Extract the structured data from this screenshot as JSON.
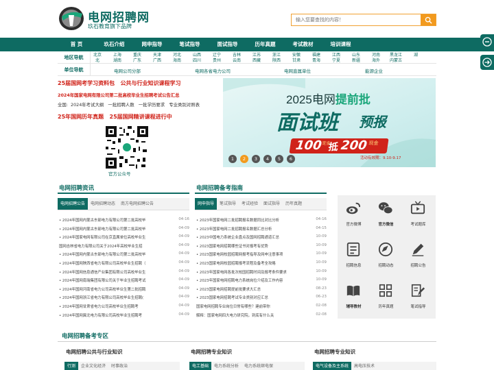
{
  "header": {
    "title": "电网招聘网",
    "subtitle": "玖石教育旗下品牌",
    "search_placeholder": "输入您要查找的内容！"
  },
  "nav": [
    "首 页",
    "玖石介绍",
    "网申指导",
    "笔试指导",
    "面试指导",
    "历年真题",
    "考试教材",
    "培训课程"
  ],
  "region": {
    "label_area": "地区导航",
    "label_unit": "单位导航",
    "provinces_row1": [
      "北京",
      "上海",
      "重庆",
      "天津",
      "河北",
      "山西",
      "辽宁",
      "吉林",
      "江苏",
      "浙江",
      "安徽",
      "福建",
      "江西",
      "山东",
      "河南",
      "黑龙江",
      "湖"
    ],
    "provinces_row2": [
      "北",
      "湖南",
      "广东",
      "广西",
      "海南",
      "四川",
      "贵州",
      "云南",
      "西藏",
      "陕西",
      "甘肃",
      "青海",
      "宁夏",
      "新疆",
      "海外",
      "内蒙古"
    ],
    "units": [
      "电网公司分部",
      "电网各省电力公司",
      "电网直属单位",
      "能源企业"
    ]
  },
  "promo": {
    "line1a": "25届国网考学习资料包",
    "line1b": "公共与行业知识课程学习",
    "line2": "2024年国家电网有限公司第二批高校毕业生招聘考试公告汇总",
    "line3": [
      "全国:",
      "2024年考试大纲",
      "一批招聘人数",
      "一批学历要求",
      "专业类别对照表"
    ],
    "line4a": "25年国网历年真题",
    "line4b": "25届国网精讲课程进行中",
    "qr_caption": "官方公众号"
  },
  "banner": {
    "year_text": "2025电网",
    "highlight": "提前批",
    "main": "面试班",
    "tag": "预报",
    "ticket_small": "定金",
    "ticket_a": "100",
    "ticket_b": "抵",
    "ticket_c": "200",
    "ticket_d": "现金",
    "date": "活动有效期：9.10-9.17",
    "dots": [
      "1",
      "2",
      "3",
      "4",
      "5",
      "6"
    ]
  },
  "news": {
    "title": "电网招聘资讯",
    "tabs": [
      "电网招聘公告",
      "电网招聘动态",
      "南方电网招聘公告"
    ],
    "items": [
      {
        "t": "• 2024年国网内蒙古东部电力有限公司第二批高校毕",
        "d": "04-16"
      },
      {
        "t": "• 2024年国网内蒙古东部电力有限公司第二批高校毕",
        "d": "04-09"
      },
      {
        "t": "• 2024年国家电网有限公司在京直属单位高校毕业生",
        "d": "04-09"
      },
      {
        "t": "  国网吉林省电力有限公司关于2024年高校毕业生招",
        "d": "04-09"
      },
      {
        "t": "• 2024年国网内蒙古东部电力有限公司第二批高校毕",
        "d": "04-09"
      },
      {
        "t": "• 2024年国网陕西省电力有限公司高校毕业生招聘（",
        "d": "04-09"
      },
      {
        "t": "• 2024年国网信息通信产业集团有限公司高校毕业生",
        "d": "04-09"
      },
      {
        "t": "• 2024年国网南瑞集团有限公司关于毕业生招聘考试",
        "d": "04-09"
      },
      {
        "t": "• 2024年国网河南省电力公司高校毕业生第二批招聘",
        "d": "04-09"
      },
      {
        "t": "• 2024年国网浙江省电力有限公司高校毕业生招聘(",
        "d": "04-09"
      },
      {
        "t": "• 2024年国网甘肃省电力公司高校毕业生招聘考",
        "d": "04-09"
      },
      {
        "t": "• 2024年国网冀北电力有限公司高校毕业生招聘考",
        "d": "04-09"
      }
    ]
  },
  "guide": {
    "title": "电网招聘备考指南",
    "tabs": [
      "网申指导",
      "笔试指导",
      "考试经验",
      "面试指导",
      "历年真题"
    ],
    "items": [
      {
        "t": "• 2023年国家电网二批招聘报名数据同比对比分析",
        "d": "04-16"
      },
      {
        "t": "• 2023年国家电网二批招聘报名数据汇总分析",
        "d": "04-15"
      },
      {
        "t": "• 2023中国电力系统企业盘点及国网招聘通道汇总",
        "d": "10-09"
      },
      {
        "t": "• 2023国家电网招聘哪些证书对报考有优势",
        "d": "10-09"
      },
      {
        "t": "• 2023国家电网校园招聘网报考指导及网申注意事项",
        "d": "10-09"
      },
      {
        "t": "• 2023国家电网校园招聘报考流程及备考全攻略",
        "d": "10-09"
      },
      {
        "t": "• 2023年国家电网各批次校园招聘时间及报考条件要求",
        "d": "10-09"
      },
      {
        "t": "• 2023年国家电网招聘电力系统岗位介绍及工作内容",
        "d": "10-09"
      },
      {
        "t": "• 2023国家电网招聘提前批要求大汇总",
        "d": "08-23"
      },
      {
        "t": "• 2023国家电网招聘考试专业类别对应汇总",
        "d": "06-23"
      },
      {
        "t": "  国家电网招聘专业岗位日常有哪些？建前带你",
        "d": "02-08"
      },
      {
        "t": "  解释：国家电网四大电力研究院，到底有什么关",
        "d": "02-08"
      }
    ]
  },
  "icons": [
    {
      "name": "weibo-icon",
      "label": "官方微博"
    },
    {
      "name": "wechat-icon",
      "label": "官方微信"
    },
    {
      "name": "tv-icon",
      "label": "考试题库"
    },
    {
      "name": "recruit-info-icon",
      "label": "招聘信息"
    },
    {
      "name": "compass-icon",
      "label": "招聘动态"
    },
    {
      "name": "pen-icon",
      "label": "招聘公告"
    },
    {
      "name": "book-icon",
      "label": "辅导教材"
    },
    {
      "name": "grid-icon",
      "label": "历年真题"
    },
    {
      "name": "notes-icon",
      "label": "笔试指导"
    }
  ],
  "prep": {
    "title": "电网招聘备考专区",
    "cols": [
      {
        "title": "电网招聘公共与行业知识",
        "tabs": [
          "行测",
          "企业文化经济",
          "时事政治"
        ]
      },
      {
        "title": "电网招聘专业知识",
        "tabs": [
          "电工基础",
          "电力系统分析",
          "电力系统继电保"
        ]
      },
      {
        "title": "电网招聘专业知识",
        "tabs": [
          "电气设备及主系统",
          "高电压技术"
        ]
      }
    ]
  },
  "colors": {
    "brand": "#0e6b62",
    "accent": "#f29a1e",
    "red": "#d0231a"
  }
}
